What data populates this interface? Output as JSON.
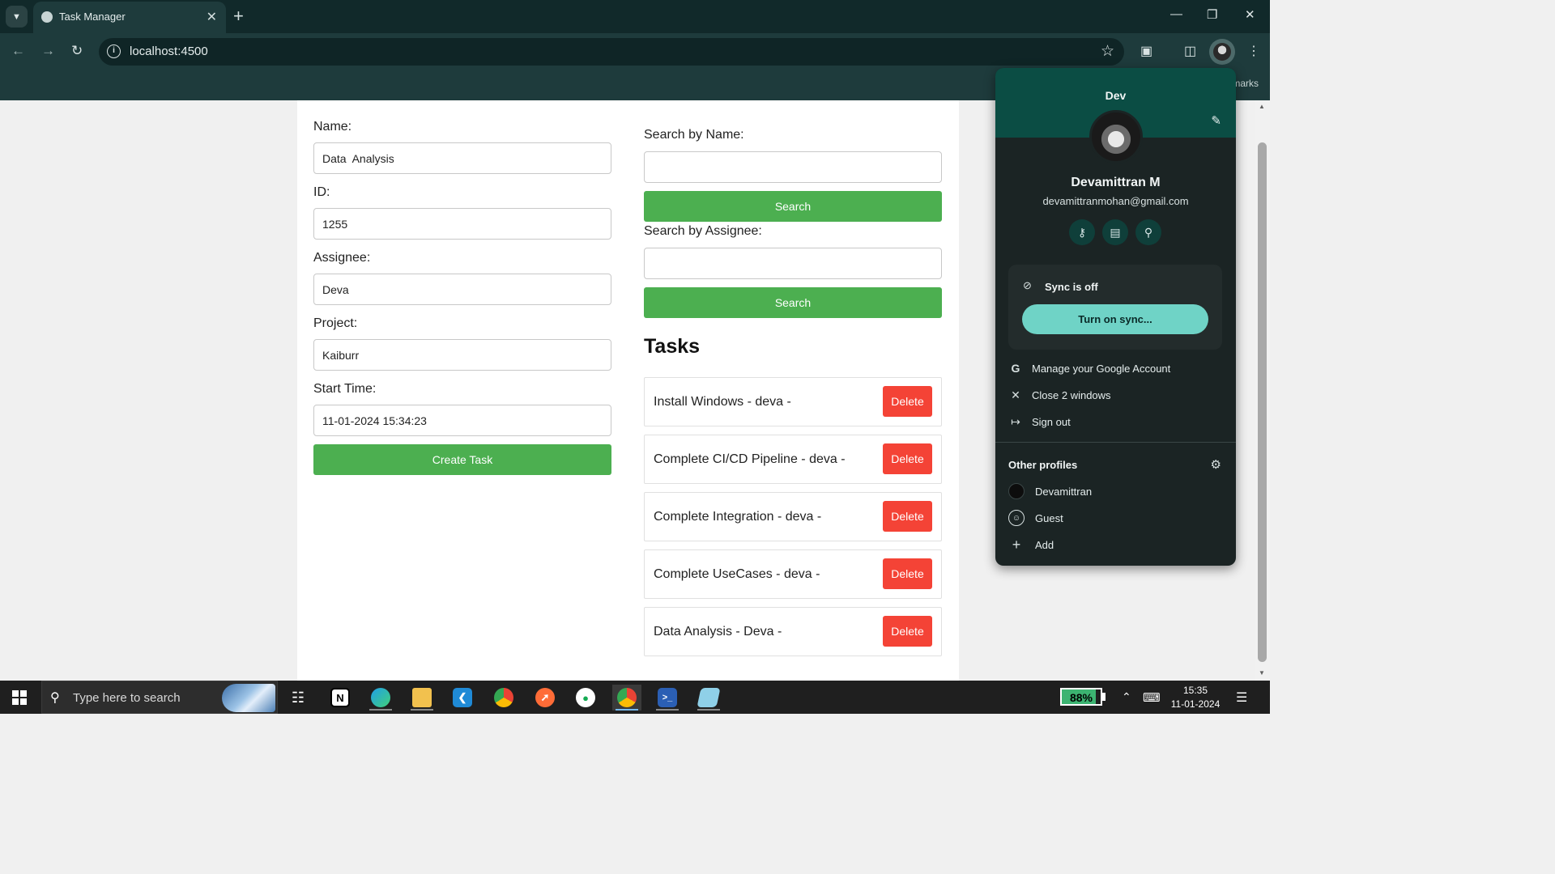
{
  "browser": {
    "tab_title": "Task Manager",
    "url": "localhost:4500",
    "bookmarks_label": "marks"
  },
  "form": {
    "name_label": "Name:",
    "name_value": "Data  Analysis",
    "id_label": "ID:",
    "id_value": "1255",
    "assignee_label": "Assignee:",
    "assignee_value": "Deva",
    "project_label": "Project:",
    "project_value": "Kaiburr",
    "start_time_label": "Start Time:",
    "start_time_value": "11-01-2024 15:34:23",
    "create_button": "Create Task"
  },
  "search": {
    "by_name_label": "Search by Name:",
    "by_name_value": "",
    "by_name_button": "Search",
    "by_assignee_label": "Search by Assignee:",
    "by_assignee_value": "",
    "by_assignee_button": "Search"
  },
  "tasks": {
    "title": "Tasks",
    "delete_label": "Delete",
    "items": [
      {
        "text": "Install Windows - deva -"
      },
      {
        "text": "Complete CI/CD Pipeline - deva -"
      },
      {
        "text": "Complete Integration - deva -"
      },
      {
        "text": "Complete UseCases - deva -"
      },
      {
        "text": "Data Analysis - Deva -"
      }
    ]
  },
  "profile_menu": {
    "header_name": "Dev",
    "full_name": "Devamittran M",
    "email": "devamittranmohan@gmail.com",
    "quick_icons": [
      "key-icon",
      "credit-card-icon",
      "location-pin-icon"
    ],
    "sync_status": "Sync is off",
    "sync_button": "Turn on sync...",
    "actions": [
      {
        "icon": "google-icon",
        "label": "Manage your Google Account"
      },
      {
        "icon": "close-icon",
        "label": "Close 2 windows"
      },
      {
        "icon": "sign-out-icon",
        "label": "Sign out"
      }
    ],
    "other_profiles_title": "Other profiles",
    "other_profiles": [
      {
        "icon": "profile-avatar-icon",
        "label": "Devamittran"
      },
      {
        "icon": "guest-icon",
        "label": "Guest"
      },
      {
        "icon": "add-icon",
        "label": "Add"
      }
    ]
  },
  "taskbar": {
    "search_placeholder": "Type here to search",
    "battery_percent": "88%",
    "battery_level": 0.88,
    "time": "15:35",
    "date": "11-01-2024",
    "apps": [
      "task-view-icon",
      "notion-icon",
      "edge-icon",
      "file-explorer-icon",
      "vscode-icon",
      "chrome-icon",
      "postman-icon",
      "mongodb-compass-icon",
      "chrome-active-icon",
      "powershell-icon",
      "notepad-icon"
    ]
  },
  "colors": {
    "chrome_frame": "#11292a",
    "chrome_toolbar": "#1e3b3c",
    "green_button": "#4caf50",
    "delete_button": "#f44336",
    "sync_button": "#6fd3c6",
    "profile_header": "#0b4d44"
  }
}
